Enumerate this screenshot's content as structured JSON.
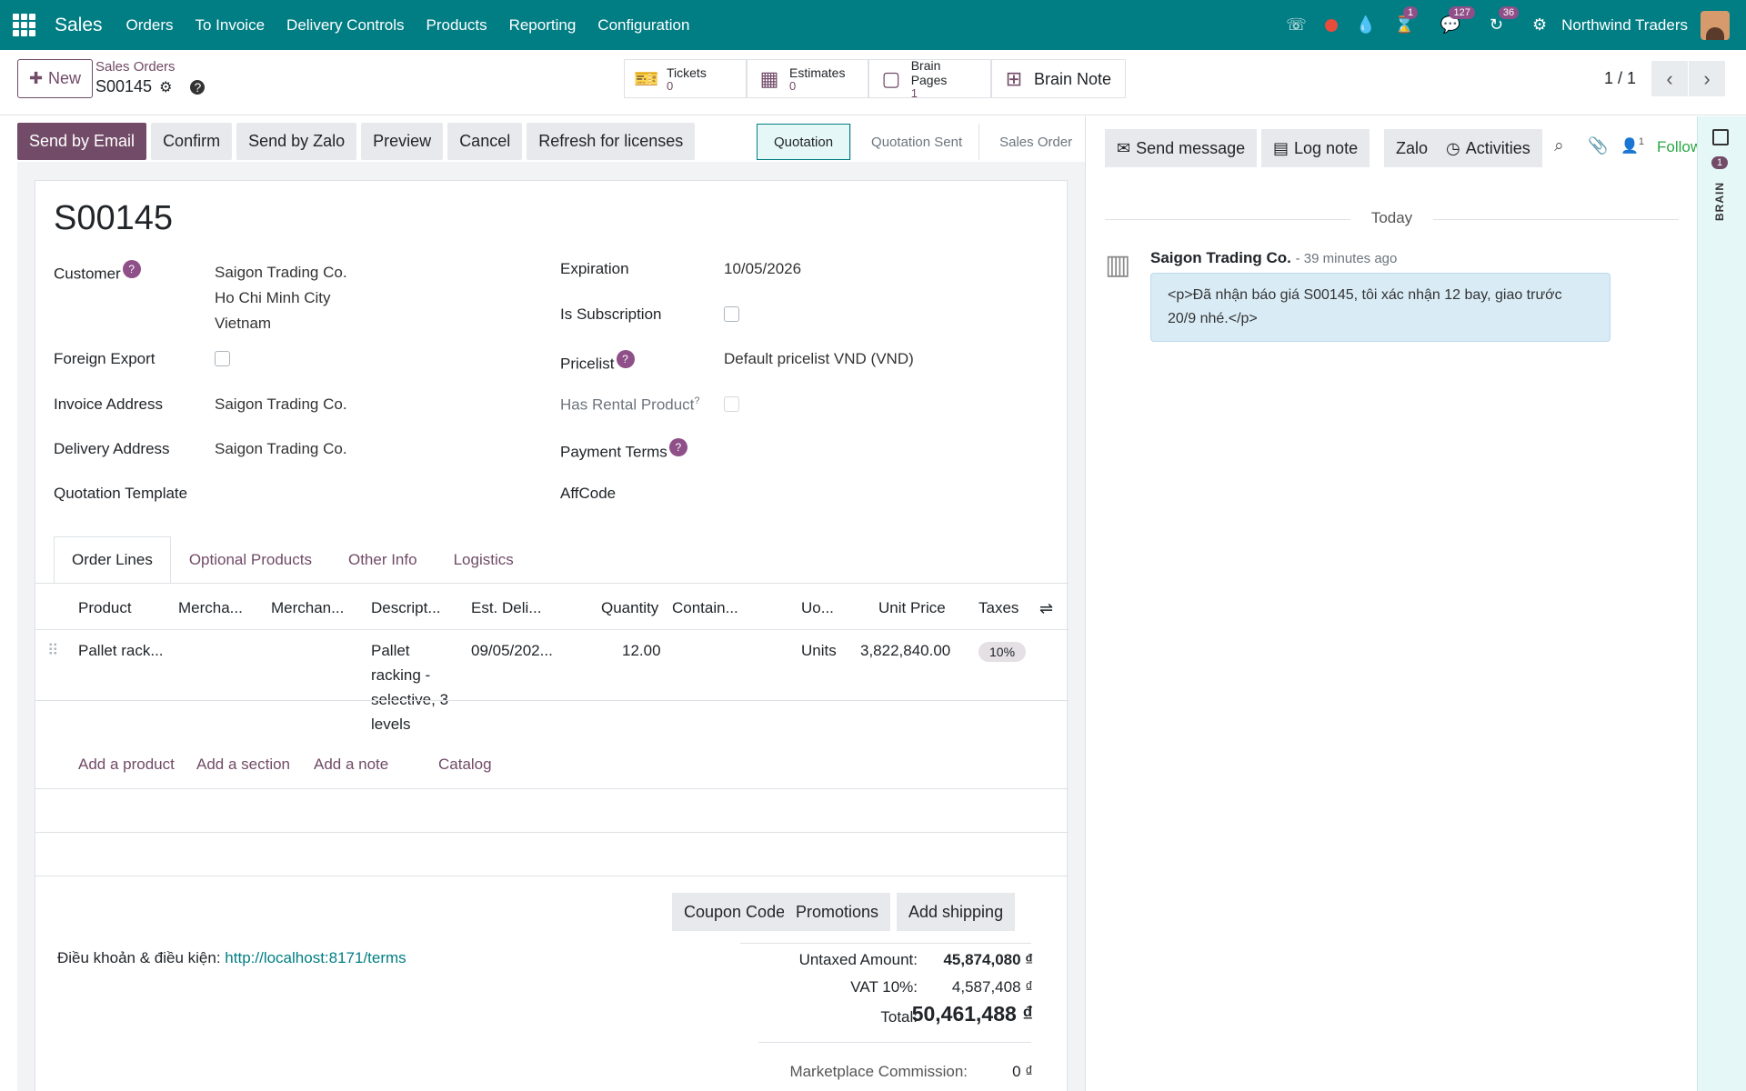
{
  "nav": {
    "app": "Sales",
    "menus": [
      "Orders",
      "To Invoice",
      "Delivery Controls",
      "Products",
      "Reporting",
      "Configuration"
    ],
    "badges": {
      "activities": "1",
      "messages": "127",
      "updates": "36"
    },
    "company": "Northwind Traders"
  },
  "control": {
    "new_label": "New",
    "breadcrumb_parent": "Sales Orders",
    "breadcrumb_current": "S00145",
    "pager": "1 / 1",
    "stats": [
      {
        "title": "Tickets",
        "value": "0",
        "icon": "ticket-icon"
      },
      {
        "title": "Estimates",
        "value": "0",
        "icon": "calculator-icon"
      },
      {
        "title": "Brain Pages",
        "value": "1",
        "icon": "note-icon"
      },
      {
        "title": "Brain Note",
        "value": "",
        "icon": "plus-square-icon"
      }
    ]
  },
  "status_buttons": [
    "Send by Email",
    "Confirm",
    "Send by Zalo",
    "Preview",
    "Cancel",
    "Refresh for licenses"
  ],
  "status_steps": [
    "Quotation",
    "Quotation Sent",
    "Sales Order"
  ],
  "record": {
    "name": "S00145",
    "left": {
      "customer_label": "Customer",
      "customer_lines": [
        "Saigon Trading Co.",
        "Ho Chi Minh City",
        "Vietnam"
      ],
      "foreign_export_label": "Foreign Export",
      "invoice_address_label": "Invoice Address",
      "invoice_address": "Saigon Trading Co.",
      "delivery_address_label": "Delivery Address",
      "delivery_address": "Saigon Trading Co.",
      "quotation_template_label": "Quotation Template"
    },
    "right": {
      "expiration_label": "Expiration",
      "expiration": "10/05/2026",
      "is_subscription_label": "Is Subscription",
      "pricelist_label": "Pricelist",
      "pricelist": "Default pricelist VND  (VND)",
      "rental_label": "Has Rental Product",
      "payment_terms_label": "Payment Terms",
      "affcode_label": "AffCode"
    }
  },
  "tabs": [
    "Order Lines",
    "Optional Products",
    "Other Info",
    "Logistics"
  ],
  "table": {
    "headers": [
      "Product",
      "Mercha...",
      "Merchan...",
      "Descript...",
      "Est. Deli...",
      "Quantity",
      "Contain...",
      "Uo...",
      "Unit Price",
      "Taxes"
    ],
    "rows": [
      {
        "product": "Pallet rack...",
        "description": [
          "Pallet",
          "racking -",
          "selective, 3",
          "levels"
        ],
        "est_delivery": "09/05/202...",
        "quantity": "12.00",
        "uom": "Units",
        "unit_price": "3,822,840.00",
        "tax": "10%"
      }
    ],
    "add_links": [
      "Add a product",
      "Add a section",
      "Add a note",
      "Catalog"
    ]
  },
  "order_buttons": [
    "Coupon Code",
    "Promotions",
    "Add shipping"
  ],
  "terms": {
    "label": "Điều khoản & điều kiện: ",
    "link": "http://localhost:8171/terms"
  },
  "totals": {
    "untaxed_label": "Untaxed Amount:",
    "untaxed": "45,874,080 ₫",
    "vat_label": "VAT 10%:",
    "vat": "4,587,408 ₫",
    "total_label": "Total:",
    "total": "50,461,488 ₫",
    "commission_label": "Marketplace Commission:",
    "commission": "0 ₫"
  },
  "chatter": {
    "send_message": "Send message",
    "log_note": "Log note",
    "zalo": "Zalo",
    "activities": "Activities",
    "followers_count": "1",
    "follow": "Follow",
    "today": "Today",
    "message": {
      "author": "Saigon Trading Co.",
      "time": "- 39 minutes ago",
      "body": "<p>Đã nhận báo giá S00145, tôi xác nhận 12 bay, giao trước 20/9 nhé.</p>"
    }
  },
  "brain": {
    "count": "1",
    "label": "BRAIN"
  }
}
